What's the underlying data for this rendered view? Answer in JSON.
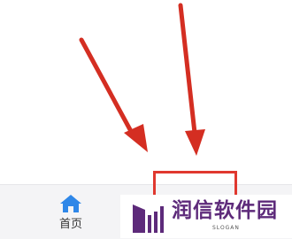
{
  "tabbar": {
    "home_label": "首页"
  },
  "watermark": {
    "brand": "润信软件园",
    "slogan": "SLOGAN"
  },
  "colors": {
    "arrow": "#d42e22",
    "highlight": "#e0382f",
    "home_icon": "#2f87e8",
    "brand": "#5d2a7a"
  },
  "icons": [
    "arrow-icon",
    "home-icon",
    "brand-logo-icon"
  ]
}
